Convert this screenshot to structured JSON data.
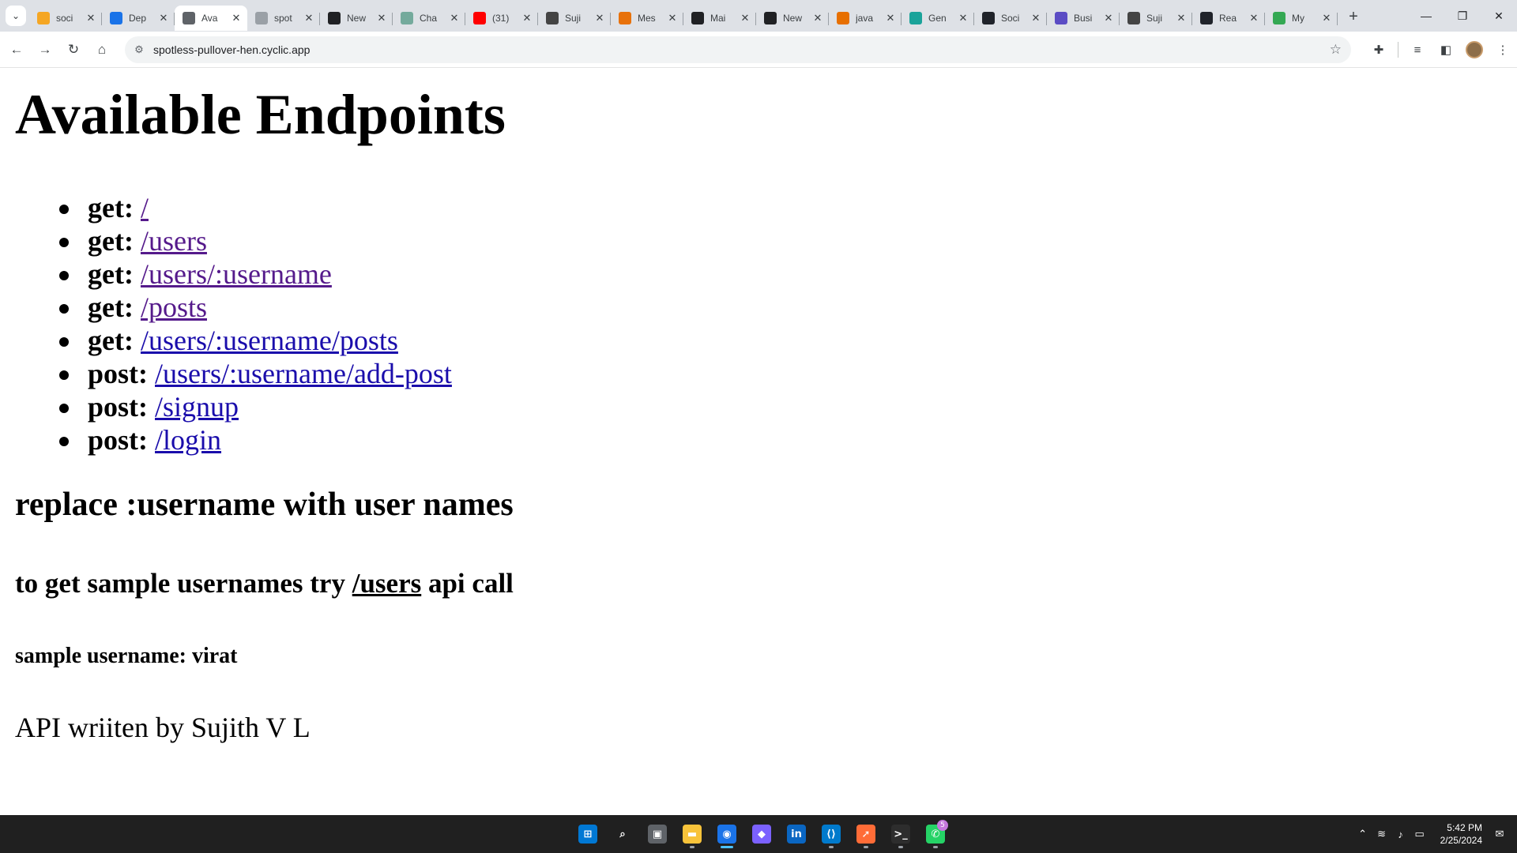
{
  "browser": {
    "tabs": [
      {
        "title": "soci",
        "favicon_color": "#f5a623"
      },
      {
        "title": "Dep",
        "favicon_color": "#1a73e8"
      },
      {
        "title": "Ava",
        "favicon_color": "#5f6368",
        "active": true
      },
      {
        "title": "spot",
        "favicon_color": "#9aa0a6"
      },
      {
        "title": "New",
        "favicon_color": "#202124"
      },
      {
        "title": "Cha",
        "favicon_color": "#74aa9c"
      },
      {
        "title": "(31)",
        "favicon_color": "#ff0000"
      },
      {
        "title": "Suji",
        "favicon_color": "#444444"
      },
      {
        "title": "Mes",
        "favicon_color": "#e8710a"
      },
      {
        "title": "Mai",
        "favicon_color": "#202124"
      },
      {
        "title": "New",
        "favicon_color": "#202124"
      },
      {
        "title": "java",
        "favicon_color": "#e76f00"
      },
      {
        "title": "Gen",
        "favicon_color": "#1aa39a"
      },
      {
        "title": "Soci",
        "favicon_color": "#20232a"
      },
      {
        "title": "Busi",
        "favicon_color": "#5b4cc4"
      },
      {
        "title": "Suji",
        "favicon_color": "#444444"
      },
      {
        "title": "Rea",
        "favicon_color": "#20232a"
      },
      {
        "title": "My",
        "favicon_color": "#34a853"
      }
    ],
    "url": "spotless-pullover-hen.cyclic.app"
  },
  "page": {
    "title": "Available Endpoints",
    "endpoints": [
      {
        "method": "get:",
        "path": "/",
        "visited": true
      },
      {
        "method": "get:",
        "path": "/users",
        "visited": true
      },
      {
        "method": "get:",
        "path": "/users/:username",
        "visited": true
      },
      {
        "method": "get:",
        "path": "/posts",
        "visited": true
      },
      {
        "method": "get:",
        "path": "/users/:username/posts",
        "visited": false
      },
      {
        "method": "post:",
        "path": "/users/:username/add-post",
        "visited": false
      },
      {
        "method": "post:",
        "path": "/signup",
        "visited": false
      },
      {
        "method": "post:",
        "path": "/login",
        "visited": false
      }
    ],
    "note": "replace :username with user names",
    "sample_hint": {
      "before": "to get sample usernames try ",
      "link": "/users",
      "after": " api call"
    },
    "sample_username": "sample username: virat",
    "credit": "API wriiten by Sujith V L",
    "colors": {
      "link": "#1a0dab",
      "visited_link": "#551a8b"
    }
  },
  "taskbar": {
    "apps": [
      {
        "name": "start",
        "label": "⊞",
        "color": "#0078d4"
      },
      {
        "name": "search",
        "label": "⌕",
        "color": "#202020"
      },
      {
        "name": "task-view",
        "label": "▣",
        "color": "#5f6368"
      },
      {
        "name": "file-explorer",
        "label": "▬",
        "color": "#f8c33a",
        "running": true
      },
      {
        "name": "chrome",
        "label": "◉",
        "color": "#1a73e8",
        "running": true,
        "active": true
      },
      {
        "name": "app-purple",
        "label": "◆",
        "color": "#7b61ff"
      },
      {
        "name": "linkedin",
        "label": "in",
        "color": "#0a66c2"
      },
      {
        "name": "vscode",
        "label": "⟨⟩",
        "color": "#007acc",
        "running": true
      },
      {
        "name": "postman",
        "label": "➚",
        "color": "#ff6c37",
        "running": true
      },
      {
        "name": "terminal",
        "label": ">_",
        "color": "#2d2d2d",
        "running": true
      },
      {
        "name": "whatsapp",
        "label": "✆",
        "color": "#25d366",
        "running": true,
        "badge": "5"
      }
    ],
    "time": "5:42 PM",
    "date": "2/25/2024"
  }
}
